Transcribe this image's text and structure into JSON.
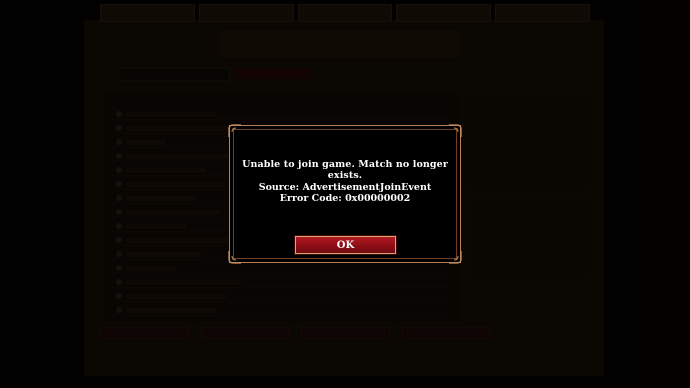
{
  "dialog": {
    "message": "Unable to join game. Match no longer exists.",
    "source": "Source: AdvertisementJoinEvent",
    "error_code": "Error Code: 0x00000002",
    "ok_label": "OK"
  },
  "colors": {
    "dialog_border": "#b9815a",
    "ok_button": "#9a111b",
    "overlay_bg": "#0a0704"
  }
}
